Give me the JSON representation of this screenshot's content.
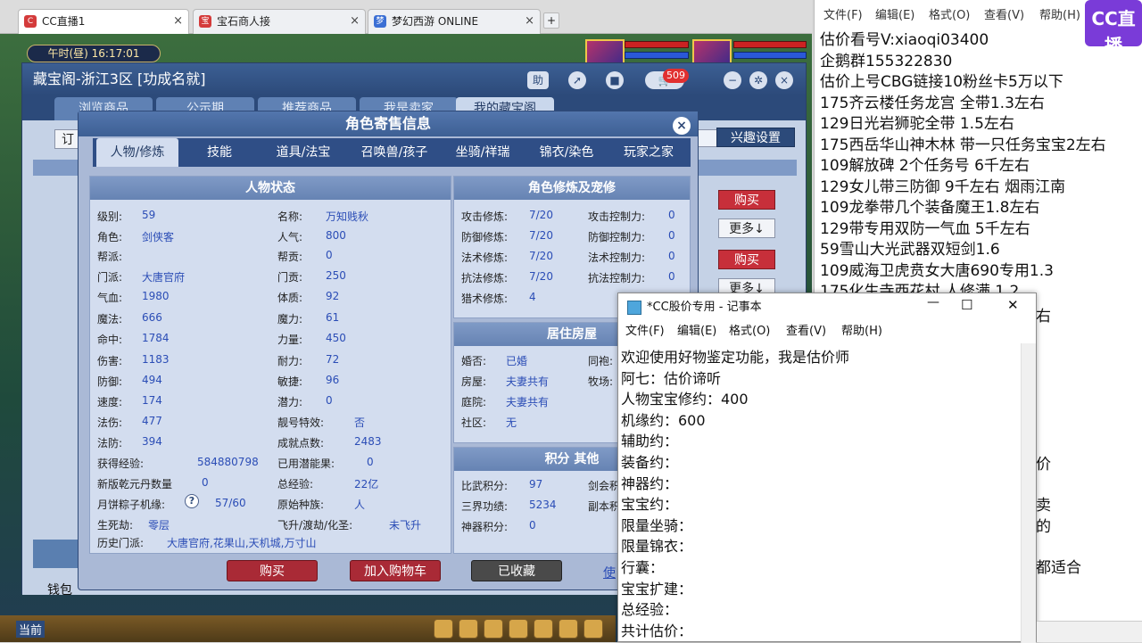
{
  "browser": {
    "tabs": [
      {
        "label": "CC直播1",
        "active": true
      },
      {
        "label": "宝石商人接",
        "active": false
      },
      {
        "label": "梦幻西游 ONLINE",
        "active": false
      }
    ],
    "new_tab": "+"
  },
  "game": {
    "clock": "午时(昼) 16:17:01",
    "badge_count": "509",
    "bottom_left": "钱包",
    "bottom_btn": "当前"
  },
  "cbg": {
    "title": "藏宝阁-浙江3区 [功成名就]",
    "help": "助",
    "tabs": [
      "浏览商品",
      "公示期",
      "推荐商品",
      "我是卖家",
      "我的藏宝阁"
    ],
    "interest_btn": "兴趣设置",
    "order_btn": "订",
    "buy": "购买",
    "more": "更多↓"
  },
  "dialog": {
    "title": "角色寄售信息",
    "close": "×",
    "tabs": [
      "人物/修炼",
      "技能",
      "道具/法宝",
      "召唤兽/孩子",
      "坐骑/祥瑞",
      "锦衣/染色",
      "玩家之家"
    ],
    "status_header": "人物状态",
    "status_left": [
      {
        "k": "级别:",
        "v": "59"
      },
      {
        "k": "角色:",
        "v": "剑侠客"
      },
      {
        "k": "帮派:",
        "v": ""
      },
      {
        "k": "门派:",
        "v": "大唐官府"
      },
      {
        "k": "气血:",
        "v": "1980"
      },
      {
        "k": "魔法:",
        "v": "666"
      },
      {
        "k": "命中:",
        "v": "1784"
      },
      {
        "k": "伤害:",
        "v": "1183"
      },
      {
        "k": "防御:",
        "v": "494"
      },
      {
        "k": "速度:",
        "v": "174"
      },
      {
        "k": "法伤:",
        "v": "477"
      },
      {
        "k": "法防:",
        "v": "394"
      },
      {
        "k": "获得经验:",
        "v": "584880798"
      },
      {
        "k": "新版乾元丹数量",
        "v": "0"
      },
      {
        "k": "月饼粽子机缘:",
        "v": "57/60"
      },
      {
        "k": "生死劫:",
        "v": "零层"
      }
    ],
    "status_right": [
      {
        "k": "名称:",
        "v": "万知贱秋"
      },
      {
        "k": "人气:",
        "v": "800"
      },
      {
        "k": "帮贡:",
        "v": "0"
      },
      {
        "k": "门贡:",
        "v": "250"
      },
      {
        "k": "体质:",
        "v": "92"
      },
      {
        "k": "魔力:",
        "v": "61"
      },
      {
        "k": "力量:",
        "v": "450"
      },
      {
        "k": "耐力:",
        "v": "72"
      },
      {
        "k": "敏捷:",
        "v": "96"
      },
      {
        "k": "潜力:",
        "v": "0"
      },
      {
        "k": "靓号特效:",
        "v": "否"
      },
      {
        "k": "成就点数:",
        "v": "2483"
      },
      {
        "k": "已用潜能果:",
        "v": "0"
      },
      {
        "k": "总经验:",
        "v": "22亿"
      },
      {
        "k": "原始种族:",
        "v": "人"
      },
      {
        "k": "飞升/渡劫/化圣:",
        "v": "未飞升"
      }
    ],
    "history_label": "历史门派:",
    "history_value": "大唐官府,花果山,天机城,万寸山",
    "help_icon": "?",
    "cultivation_header": "角色修炼及宠修",
    "cultivation": [
      {
        "k": "攻击修炼:",
        "v": "7/20",
        "k2": "攻击控制力:",
        "v2": "0"
      },
      {
        "k": "防御修炼:",
        "v": "7/20",
        "k2": "防御控制力:",
        "v2": "0"
      },
      {
        "k": "法术修炼:",
        "v": "7/20",
        "k2": "法术控制力:",
        "v2": "0"
      },
      {
        "k": "抗法修炼:",
        "v": "7/20",
        "k2": "抗法控制力:",
        "v2": "0"
      },
      {
        "k": "猎术修炼:",
        "v": "4",
        "k2": "",
        "v2": ""
      }
    ],
    "house_header": "居住房屋",
    "house": [
      {
        "k": "婚否:",
        "v": "已婚",
        "k2": "同袍:"
      },
      {
        "k": "房屋:",
        "v": "夫妻共有",
        "k2": "牧场:"
      },
      {
        "k": "庭院:",
        "v": "夫妻共有",
        "k2": ""
      },
      {
        "k": "社区:",
        "v": "无",
        "k2": ""
      }
    ],
    "points_header": "积分 其他",
    "points": [
      {
        "k": "比武积分:",
        "v": "97",
        "k2": "剑会积"
      },
      {
        "k": "三界功绩:",
        "v": "5234",
        "k2": "副本积"
      },
      {
        "k": "神器积分:",
        "v": "0",
        "k2": ""
      }
    ],
    "btn_buy": "购买",
    "btn_cart": "加入购物车",
    "btn_fav": "已收藏",
    "link_use": "使"
  },
  "notepad_right": {
    "menu": [
      "文件(F)",
      "编辑(E)",
      "格式(O)",
      "查看(V)",
      "帮助(H)"
    ],
    "lines": [
      "估价看号V:xiaoqi03400",
      "企鹅群155322830",
      "估价上号CBG链接10粉丝卡5万以下",
      "175齐云楼任务龙宫  全带1.3左右",
      "129日光岩狮驼全带  1.5左右",
      "175西岳华山神木林 带一只任务宝宝2左右",
      "109解放碑 2个任务号 6千左右",
      "129女儿带三防御 9千左右 烟雨江南",
      "109龙拳带几个装备魔王1.8左右",
      "129带专用双防一气血 5千左右",
      "59雪山大光武器双短剑1.6",
      "109威海卫虎贲女大唐690专用1.3",
      "175化生寺西花村 人修满 1.2"
    ],
    "overflow": [
      "右",
      "价",
      "卖",
      "的",
      "都适合"
    ],
    "logo_text": "CC直播"
  },
  "notepad": {
    "title": "*CC股价专用 - 记事本",
    "menu": [
      "文件(F)",
      "编辑(E)",
      "格式(O)",
      "查看(V)",
      "帮助(H)"
    ],
    "lines": [
      "欢迎使用好物鉴定功能，我是估价师",
      "阿七：估价谛听",
      "人物宝宝修约：400",
      "机缘约：600",
      "辅助约：",
      "装备约：",
      "神器约：",
      "宝宝约：",
      "限量坐骑：",
      "限量锦衣：",
      "行囊：",
      "宝宝扩建：",
      "总经验：",
      "共计估价："
    ],
    "btn_min": "—",
    "btn_max": "☐",
    "btn_close": "✕"
  }
}
